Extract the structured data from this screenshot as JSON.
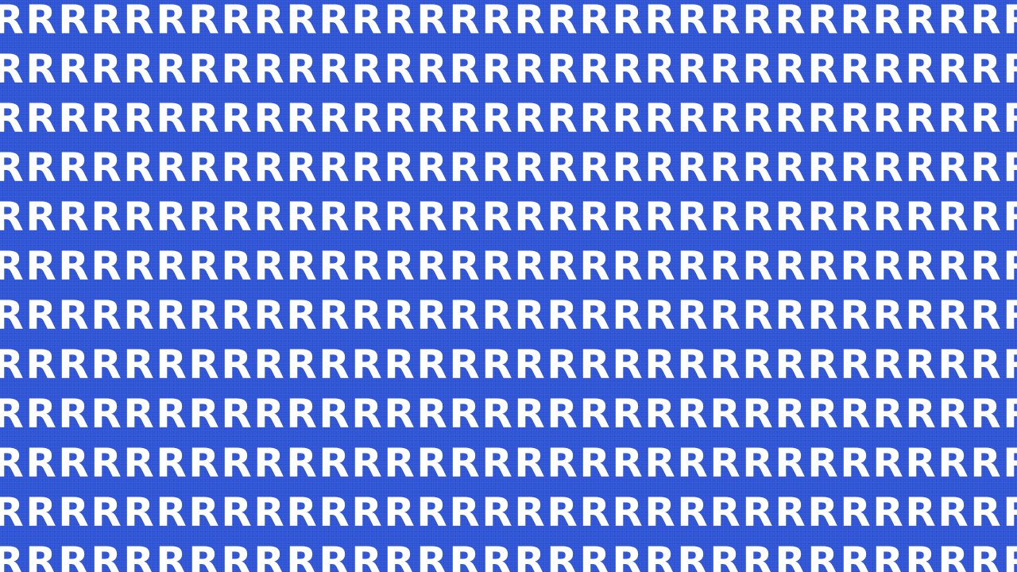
{
  "pattern": {
    "glyph": "R",
    "rows": 12,
    "columns": 32
  },
  "colors": {
    "background": "#2f55d6",
    "glyph": "#ffffff"
  }
}
